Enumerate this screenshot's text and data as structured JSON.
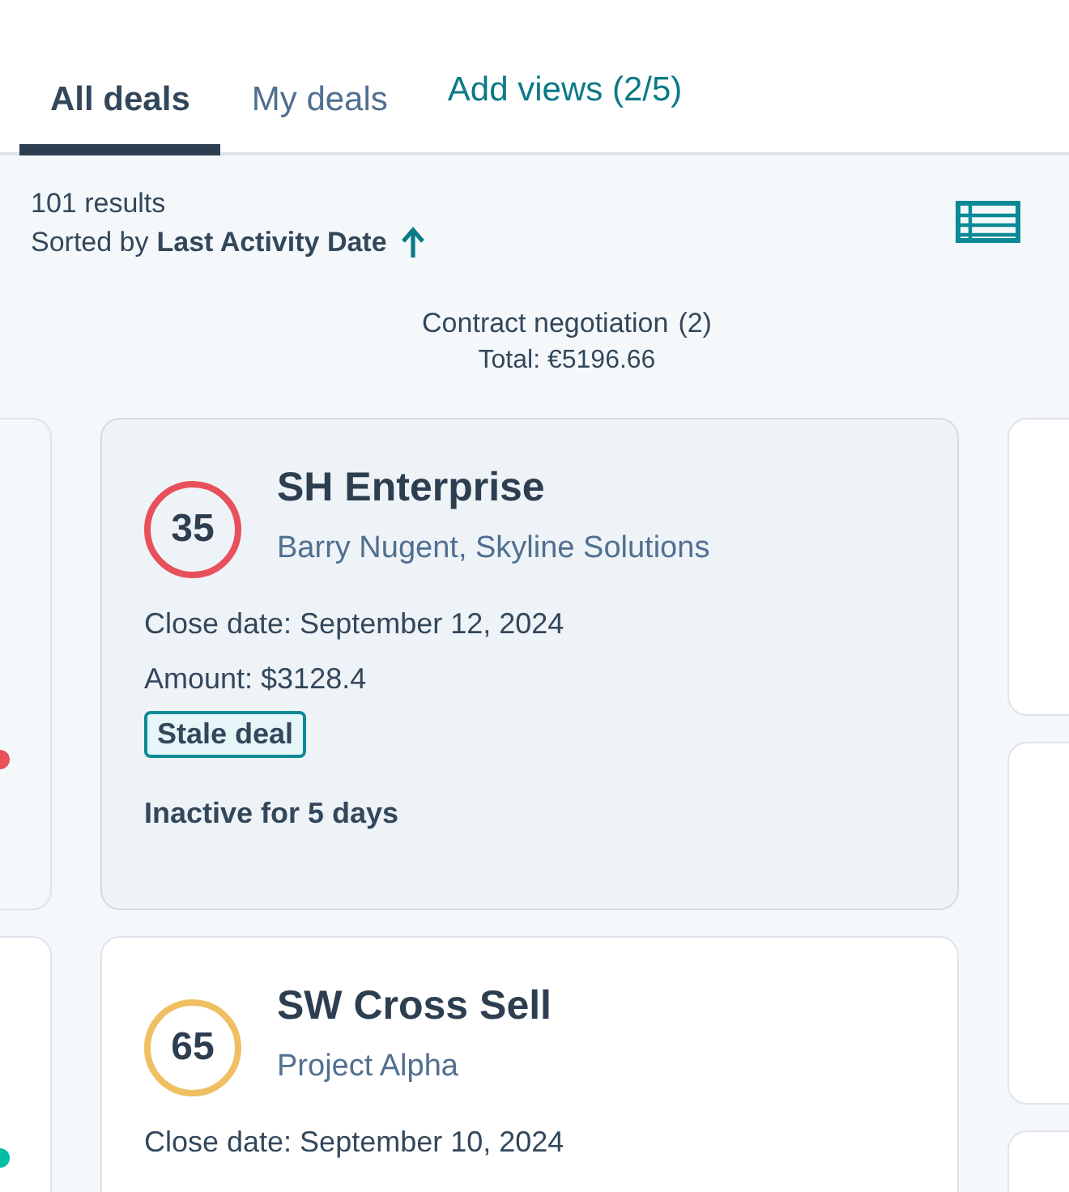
{
  "tabs": [
    {
      "label": "All deals",
      "selected": true
    },
    {
      "label": "My deals",
      "selected": false
    }
  ],
  "add_views": "Add views (2/5)",
  "results": "101 results",
  "sort": {
    "prefix": "Sorted by",
    "field": "Last Activity Date"
  },
  "stage": {
    "title": "Contract negotiation",
    "count": "(2)",
    "total": "Total: €5196.66"
  },
  "left_cards": [
    {
      "color": "#e8505b"
    },
    {
      "color": "#00bda5"
    }
  ],
  "cards": [
    {
      "score": "35",
      "color": "#e8505b",
      "selected": true,
      "title": "SH Enterprise",
      "subtitle": "Barry Nugent, Skyline Solutions",
      "close_date": "Close date: September 12, 2024",
      "amount": "Amount: $3128.4",
      "tag": "Stale deal",
      "note": "Inactive for 5 days"
    },
    {
      "score": "65",
      "color": "#f0bf62",
      "selected": false,
      "title": "SW Cross Sell",
      "subtitle": "Project Alpha",
      "close_date": "Close date: September 10, 2024"
    }
  ]
}
